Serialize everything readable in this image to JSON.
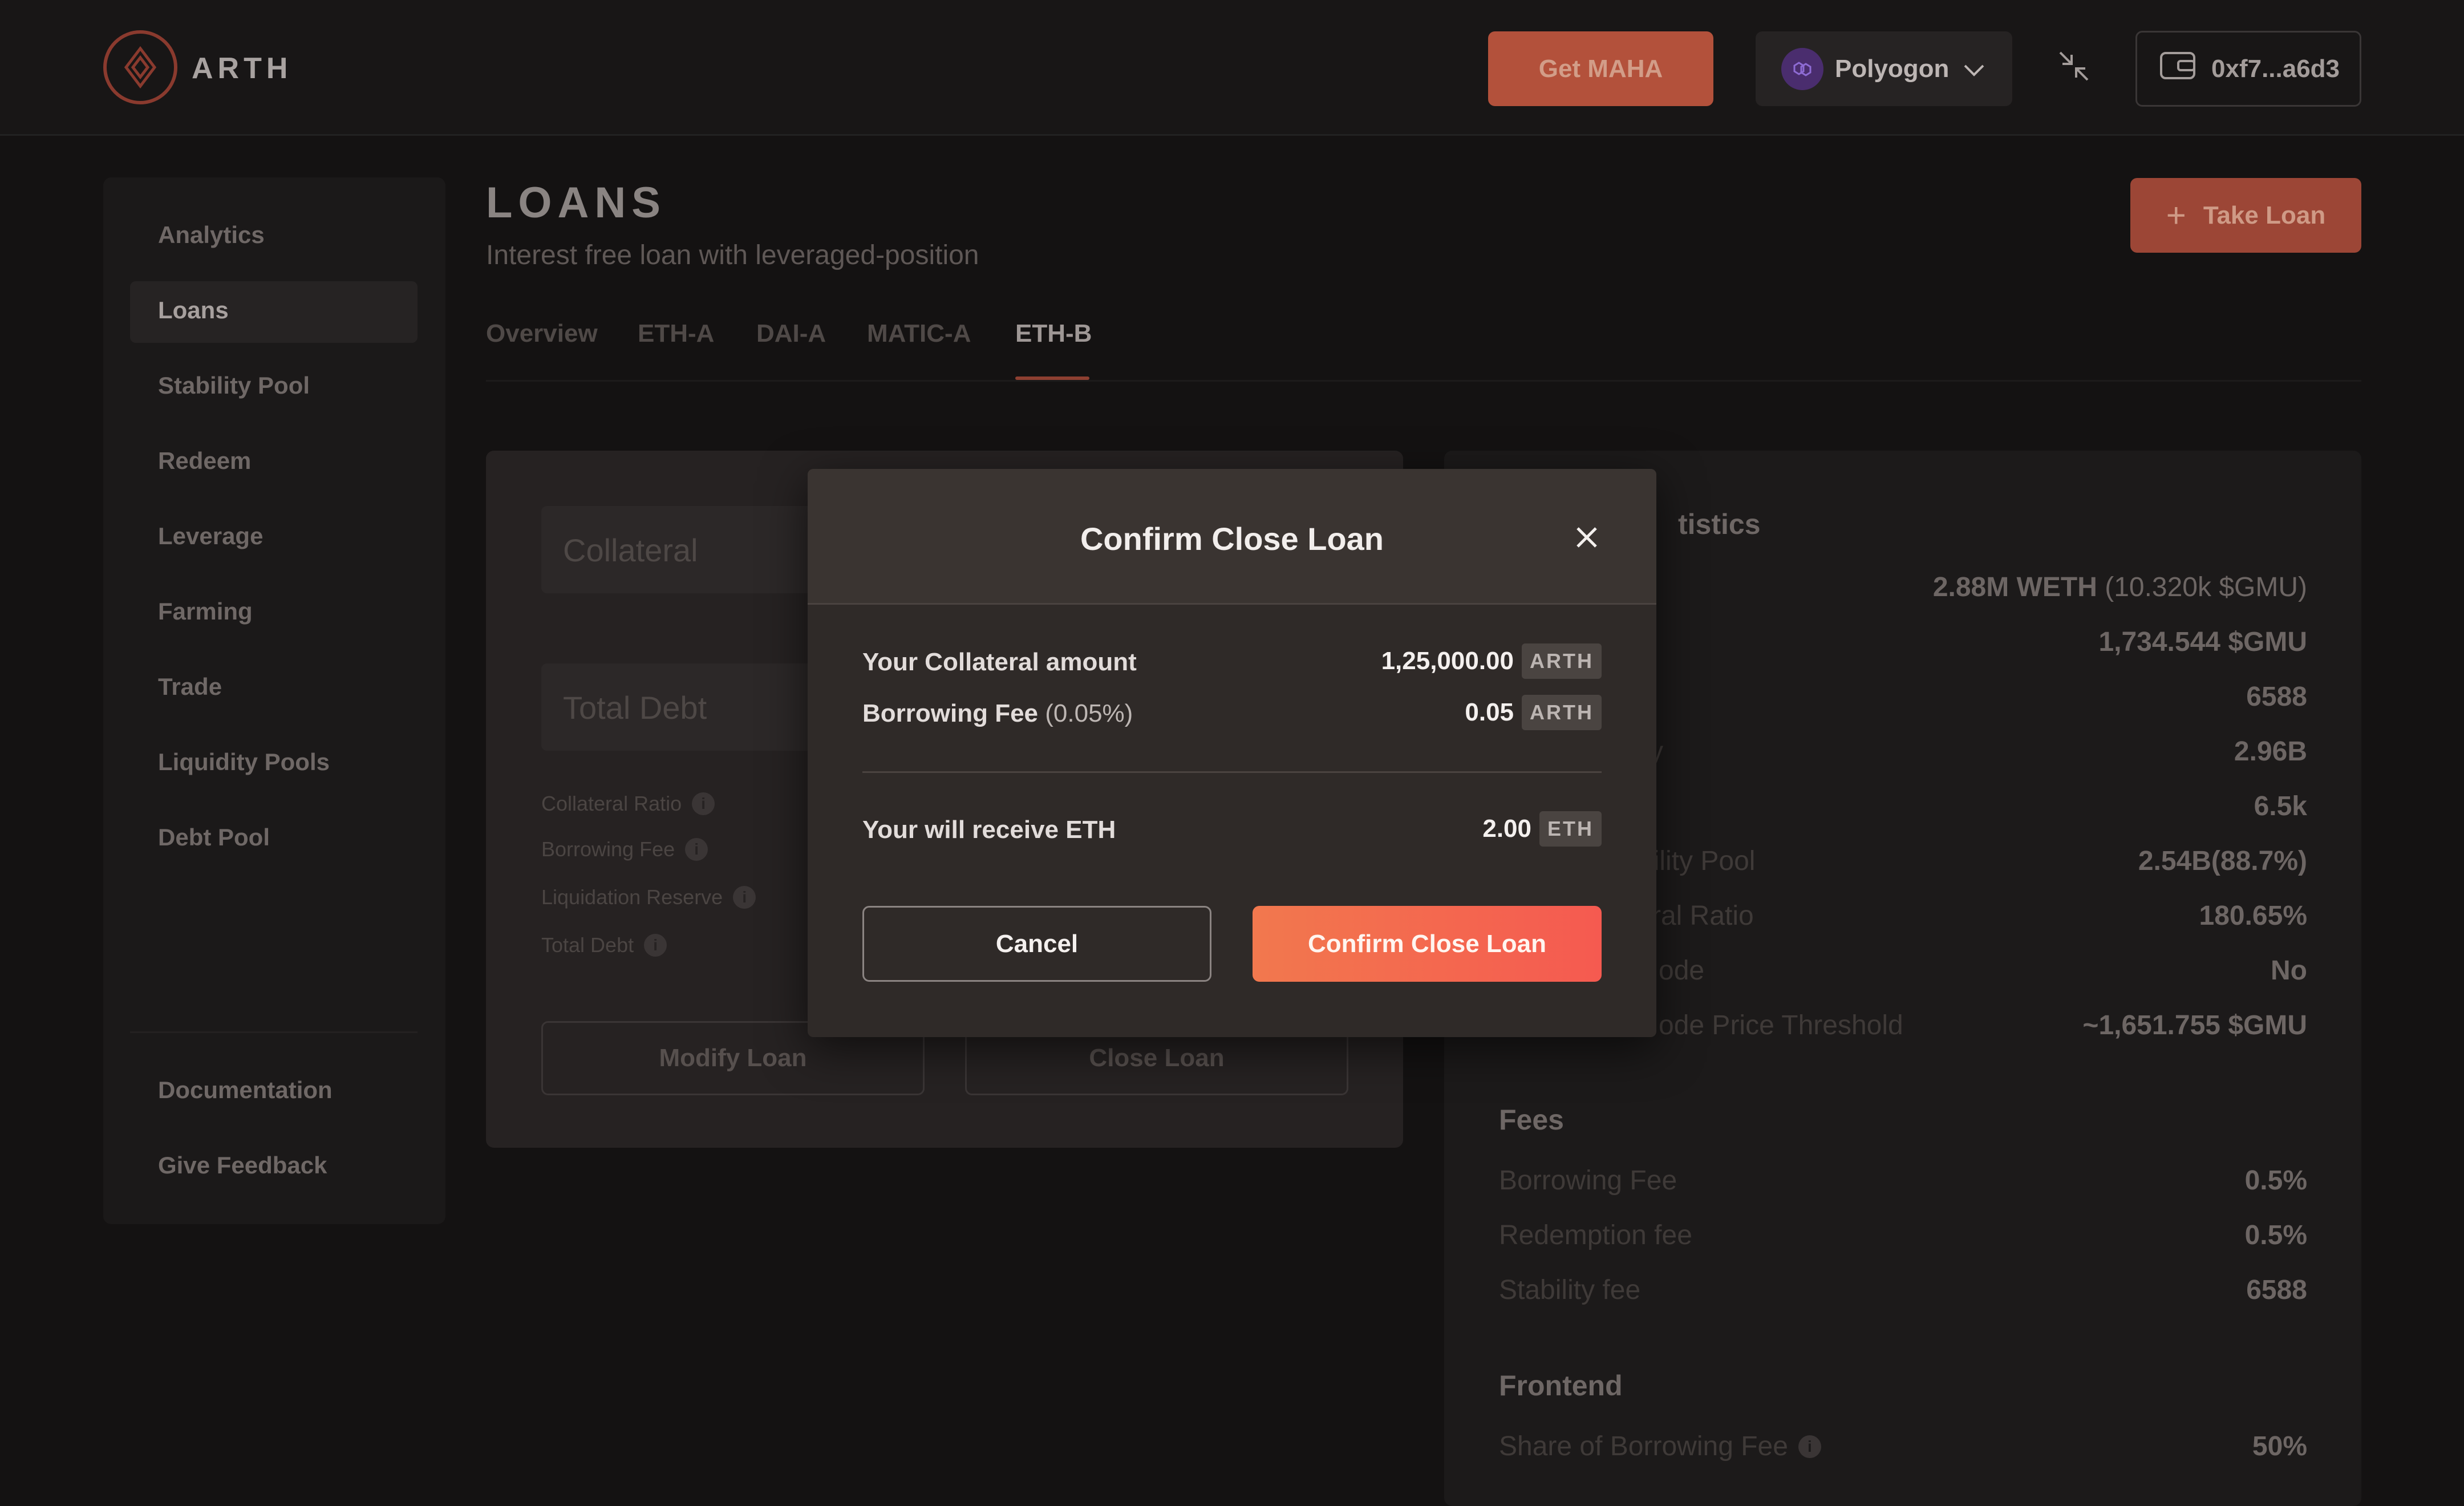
{
  "header": {
    "logo_text": "ARTH",
    "get_maha_label": "Get MAHA",
    "network_label": "Polyogon",
    "wallet_label": "0xf7...a6d3",
    "colors": {
      "accent": "#f2784e",
      "brand": "#8a3a2e"
    }
  },
  "sidebar": {
    "items": [
      {
        "label": "Analytics"
      },
      {
        "label": "Loans",
        "active": true
      },
      {
        "label": "Stability Pool"
      },
      {
        "label": "Redeem"
      },
      {
        "label": "Leverage"
      },
      {
        "label": "Farming"
      },
      {
        "label": "Trade"
      },
      {
        "label": "Liquidity Pools"
      },
      {
        "label": "Debt Pool"
      }
    ],
    "footer_items": [
      {
        "label": "Documentation"
      },
      {
        "label": "Give Feedback"
      }
    ]
  },
  "main": {
    "title": "LOANS",
    "subtitle": "Interest free loan with leveraged-position",
    "take_loan_label": "Take Loan",
    "tabs": [
      {
        "label": "Overview"
      },
      {
        "label": "ETH-A"
      },
      {
        "label": "DAI-A"
      },
      {
        "label": "MATIC-A"
      },
      {
        "label": "ETH-B",
        "active": true
      }
    ],
    "loan_card": {
      "collateral_placeholder": "Collateral",
      "total_debt_placeholder": "Total Debt",
      "stats": [
        {
          "label": "Collateral Ratio"
        },
        {
          "label": "Borrowing Fee"
        },
        {
          "label": "Liquidation Reserve"
        },
        {
          "label": "Total Debt"
        }
      ],
      "modify_label": "Modify Loan",
      "close_label": "Close Loan"
    },
    "statistics": {
      "title_fragment": "tistics",
      "rows": [
        {
          "label": "",
          "value": "2.88M WETH",
          "extra": "(10.320k $GMU)"
        },
        {
          "label": "",
          "value": "1,734.544 $GMU"
        },
        {
          "label": "",
          "value": "6588"
        },
        {
          "label": "y",
          "value": "2.96B"
        },
        {
          "label": "",
          "value": "6.5k"
        },
        {
          "label": "bility Pool",
          "value": "2.54B(88.7%)"
        },
        {
          "label": "ral Ratio",
          "value": "180.65%"
        },
        {
          "label": "ode",
          "value": "No"
        },
        {
          "label": "ode Price Threshold",
          "value": "~1,651.755 $GMU"
        }
      ],
      "fees_title": "Fees",
      "fees": [
        {
          "label": "Borrowing Fee",
          "value": "0.5%"
        },
        {
          "label": "Redemption fee",
          "value": "0.5%"
        },
        {
          "label": "Stability fee",
          "value": "6588"
        }
      ],
      "frontend_title": "Frontend",
      "frontend": [
        {
          "label": "Share of Borrowing Fee",
          "value": "50%"
        }
      ]
    }
  },
  "modal": {
    "title": "Confirm Close Loan",
    "rows": [
      {
        "label": "Your Collateral amount",
        "label_extra": "",
        "value": "1,25,000.00",
        "unit": "ARTH"
      },
      {
        "label": "Borrowing Fee",
        "label_extra": "(0.05%)",
        "value": "0.05",
        "unit": "ARTH"
      }
    ],
    "receive": {
      "label": "Your will receive ETH",
      "value": "2.00",
      "unit": "ETH"
    },
    "cancel_label": "Cancel",
    "confirm_label": "Confirm Close Loan"
  }
}
